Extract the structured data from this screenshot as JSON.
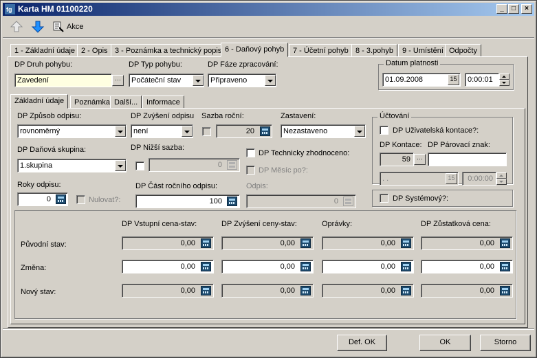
{
  "window": {
    "title": "Karta HM 01100220"
  },
  "toolbar": {
    "action_label": "Akce"
  },
  "main_tabs": [
    {
      "label": "1 - Základní údaje"
    },
    {
      "label": "2 - Opis"
    },
    {
      "label": "3 - Poznámka a technický popis"
    },
    {
      "label": "6 - Daňový pohyb"
    },
    {
      "label": "7 - Účetní pohyb"
    },
    {
      "label": "8 - 3.pohyb"
    },
    {
      "label": "9 - Umístění"
    },
    {
      "label": "Odpočty"
    }
  ],
  "header": {
    "druh_label": "DP Druh pohybu:",
    "druh_value": "Zavedení",
    "typ_label": "DP Typ pohybu:",
    "typ_value": "Počáteční stav",
    "faze_label": "DP Fáze zpracování:",
    "faze_value": "Připraveno",
    "datum_group": "Datum platnosti",
    "datum_value": "01.09.2008",
    "cas_value": "0:00:01"
  },
  "sub_tabs": [
    {
      "label": "Základní údaje"
    },
    {
      "label": "Poznámka"
    },
    {
      "label": "Další..."
    },
    {
      "label": "Informace"
    }
  ],
  "form": {
    "zpusob_label": "DP Způsob odpisu:",
    "zpusob_value": "rovnoměrný",
    "zvyseni_label": "DP Zvýšení odpisu",
    "zvyseni_value": "není",
    "sazba_label": "Sazba roční:",
    "sazba_value": "20",
    "zastaveni_label": "Zastavení:",
    "zastaveni_value": "Nezastaveno",
    "skupina_label": "DP Daňová skupina:",
    "skupina_value": "1.skupina",
    "nizsi_label": "DP Nižší sazba:",
    "nizsi_value": "0",
    "tech_label": "DP Technicky zhodnoceno:",
    "mesic_label": "DP Měsíc po?:",
    "roky_label": "Roky odpisu:",
    "roky_value": "0",
    "nulovat_label": "Nulovat?:",
    "cast_label": "DP Část ročního odpisu:",
    "cast_value": "100",
    "odpis_label": "Odpis:",
    "odpis_value": "0"
  },
  "uctovani": {
    "group": "Účtování",
    "uziv_label": "DP Uživatelská kontace?:",
    "kontace_label": "DP Kontace:",
    "kontace_value": "59",
    "parovaci_label": "DP Párovací znak:",
    "parovaci_value": "",
    "date_value": " .  .",
    "time_value": "0:00:00"
  },
  "systemovy_label": "DP Systémový?:",
  "values_table": {
    "columns": [
      "DP Vstupní cena-stav:",
      "DP Zvýšení ceny-stav:",
      "Oprávky:",
      "DP Zůstatková cena:"
    ],
    "rows": [
      {
        "label": "Původní stav:",
        "values": [
          "0,00",
          "0,00",
          "0,00",
          "0,00"
        ]
      },
      {
        "label": "Změna:",
        "values": [
          "0,00",
          "0,00",
          "0,00",
          "0,00"
        ]
      },
      {
        "label": "Nový stav:",
        "values": [
          "0,00",
          "0,00",
          "0,00",
          "0,00"
        ]
      }
    ]
  },
  "buttons": {
    "def_ok": "Def. OK",
    "ok": "OK",
    "storno": "Storno"
  }
}
